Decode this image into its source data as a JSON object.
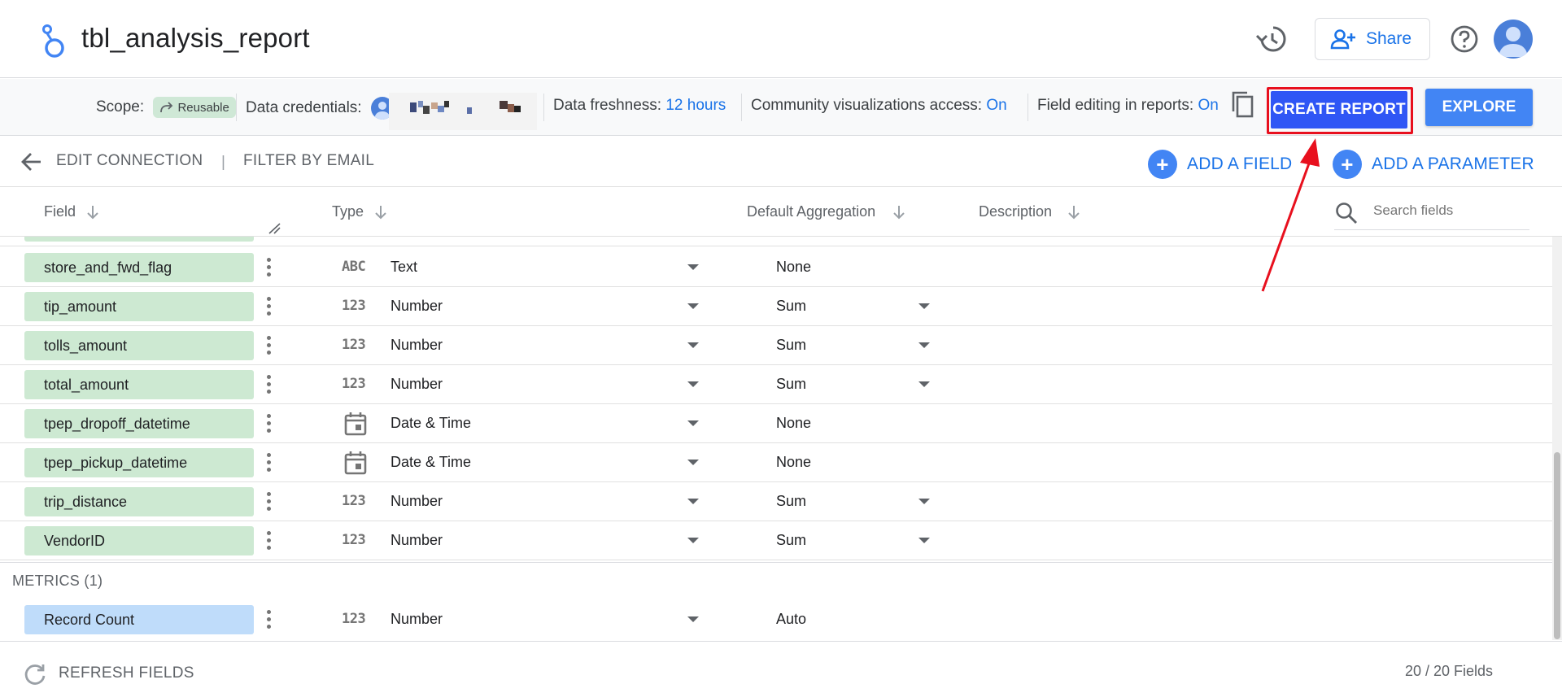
{
  "header": {
    "title": "tbl_analysis_report",
    "share_label": "Share",
    "icons": [
      "looker-studio-logo-icon",
      "history-icon",
      "add-person-icon",
      "help-icon",
      "account-avatar-icon"
    ]
  },
  "settings_bar": {
    "scope_label": "Scope:",
    "scope_chip": "Reusable",
    "credentials_label": "Data credentials:",
    "freshness_label": "Data freshness:",
    "freshness_value": "12 hours",
    "community_label": "Community visualizations access:",
    "community_value": "On",
    "field_editing_label": "Field editing in reports:",
    "field_editing_value": "On",
    "create_report_label": "CREATE REPORT",
    "explore_label": "EXPLORE"
  },
  "toolbar": {
    "edit_connection": "EDIT CONNECTION",
    "separator": "|",
    "filter_by_email": "FILTER BY EMAIL",
    "add_field": "ADD A FIELD",
    "add_parameter": "ADD A PARAMETER"
  },
  "columns": {
    "field": "Field",
    "type": "Type",
    "default_aggregation": "Default Aggregation",
    "description": "Description",
    "search_placeholder": "Search fields"
  },
  "dimensions": [
    {
      "name": "store_and_fwd_flag",
      "type_icon": "ABC",
      "type": "Text",
      "aggregation": "None",
      "agg_dropdown": false
    },
    {
      "name": "tip_amount",
      "type_icon": "123",
      "type": "Number",
      "aggregation": "Sum",
      "agg_dropdown": true
    },
    {
      "name": "tolls_amount",
      "type_icon": "123",
      "type": "Number",
      "aggregation": "Sum",
      "agg_dropdown": true
    },
    {
      "name": "total_amount",
      "type_icon": "123",
      "type": "Number",
      "aggregation": "Sum",
      "agg_dropdown": true
    },
    {
      "name": "tpep_dropoff_datetime",
      "type_icon": "calendar",
      "type": "Date & Time",
      "aggregation": "None",
      "agg_dropdown": false
    },
    {
      "name": "tpep_pickup_datetime",
      "type_icon": "calendar",
      "type": "Date & Time",
      "aggregation": "None",
      "agg_dropdown": false
    },
    {
      "name": "trip_distance",
      "type_icon": "123",
      "type": "Number",
      "aggregation": "Sum",
      "agg_dropdown": true
    },
    {
      "name": "VendorID",
      "type_icon": "123",
      "type": "Number",
      "aggregation": "Sum",
      "agg_dropdown": true
    }
  ],
  "metrics_section": {
    "label": "METRICS (1)",
    "rows": [
      {
        "name": "Record Count",
        "type_icon": "123",
        "type": "Number",
        "aggregation": "Auto",
        "agg_dropdown": false
      }
    ]
  },
  "footer": {
    "refresh_label": "REFRESH FIELDS",
    "field_count": "20 / 20 Fields"
  },
  "colors": {
    "accent_blue": "#1a73e8",
    "create_report_bg": "#2f56f5",
    "explore_bg": "#4285f4",
    "dimension_chip": "#cde9d2",
    "metric_chip": "#bfdcfa",
    "annotation_red": "#e8101e"
  }
}
